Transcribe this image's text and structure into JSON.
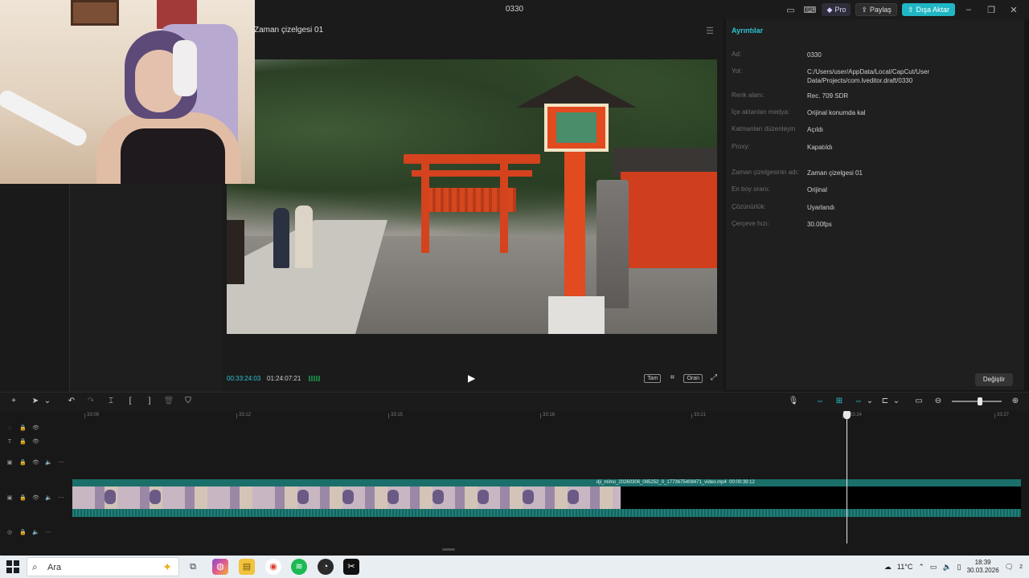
{
  "window": {
    "title": "0330",
    "pro_label": "Pro",
    "share_label": "Paylaş",
    "export_label": "Dışa Aktar"
  },
  "player": {
    "title": "Zaman çizelgesi 01",
    "current_time": "00:33:24:03",
    "total_time": "01:24:07:21",
    "ratio_label": "Oran",
    "full_label": "Tam"
  },
  "details": {
    "header": "Ayrıntılar",
    "rows": [
      {
        "label": "Ad:",
        "value": "0330"
      },
      {
        "label": "Yol:",
        "value": "C:/Users/user/AppData/Local/CapCut/User Data/Projects/com.lveditor.draft/0330"
      },
      {
        "label": "Renk alanı:",
        "value": "Rec. 709 SDR"
      },
      {
        "label": "İçe aktarılan medya:",
        "value": "Orijinal konumda kal"
      },
      {
        "label": "Katmanları düzenleyin",
        "value": "Açıldı"
      },
      {
        "label": "Proxy:",
        "value": "Kapatıldı"
      },
      {
        "label": "Zaman çizelgesinin adı:",
        "value": "Zaman çizelgesi 01"
      },
      {
        "label": "En boy oranı:",
        "value": "Orijinal"
      },
      {
        "label": "Çözünürlük:",
        "value": "Uyarlandı"
      },
      {
        "label": "Çerçeve hızı:",
        "value": "30.00fps"
      }
    ],
    "change_button": "Değiştir"
  },
  "timeline": {
    "ruler_labels": [
      "33:09",
      "33:12",
      "33:15",
      "33:18",
      "33:21",
      "33:24",
      "33:27"
    ],
    "clip_title": "dji_mimo_20260306_085252_0_1773675408471_video.mp4",
    "clip_duration": "00:00:39:12"
  },
  "taskbar": {
    "search_placeholder": "Ara",
    "weather": "11°C",
    "time": "18:39",
    "date": "30.03.2026",
    "notification_count": "2"
  }
}
